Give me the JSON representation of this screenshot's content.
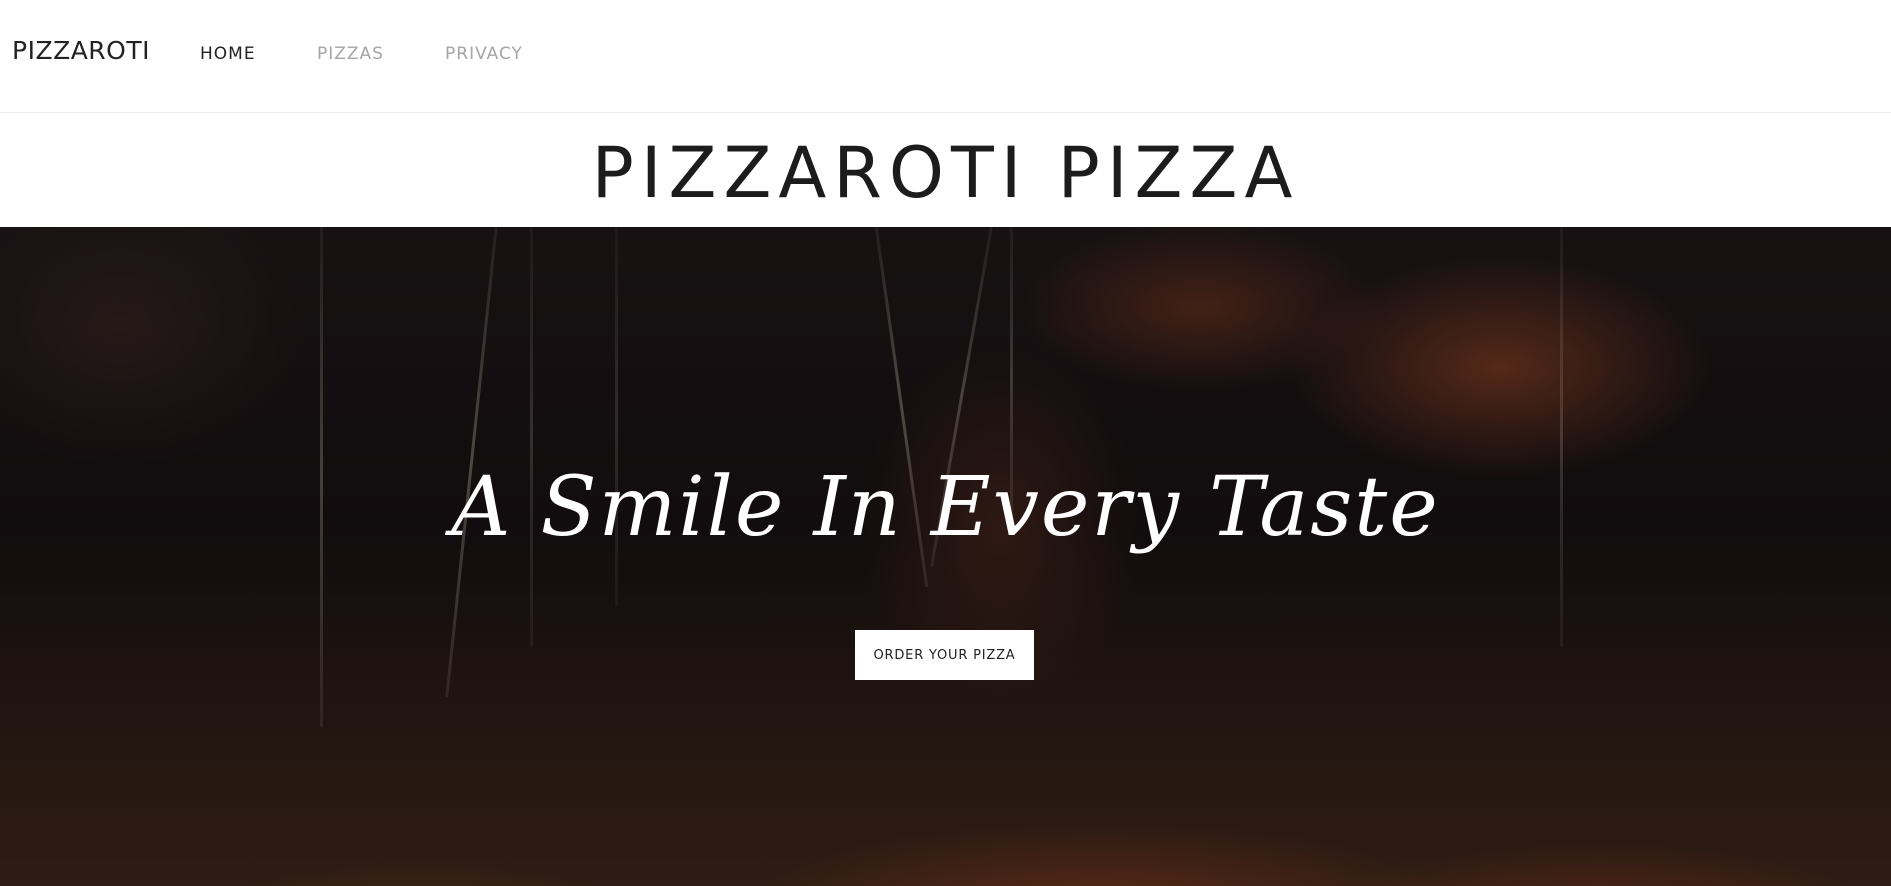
{
  "navbar": {
    "brand": "PIZZAROTI",
    "links": [
      {
        "label": "HOME",
        "active": true
      },
      {
        "label": "PIZZAS",
        "active": false
      },
      {
        "label": "PRIVACY",
        "active": false
      }
    ]
  },
  "header": {
    "title": "PIZZAROTI PIZZA"
  },
  "hero": {
    "tagline": "A Smile In Every Taste",
    "cta_label": "ORDER YOUR PIZZA"
  },
  "colors": {
    "text_dark": "#222222",
    "nav_inactive": "#a5a5a5",
    "hero_text": "#ffffff",
    "button_bg": "#ffffff"
  }
}
